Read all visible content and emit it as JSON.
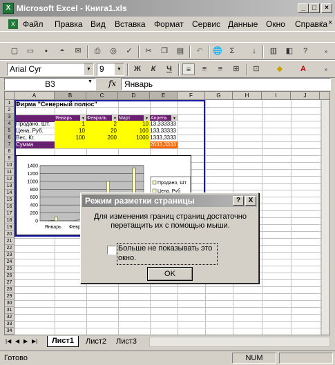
{
  "app": {
    "title": "Microsoft Excel - Книга1.xls"
  },
  "menu": [
    "Файл",
    "Правка",
    "Вид",
    "Вставка",
    "Формат",
    "Сервис",
    "Данные",
    "Окно",
    "Справка"
  ],
  "formatting": {
    "font": "Arial Cyr",
    "size": "9",
    "bold": "Ж",
    "italic": "К",
    "underline": "Ч",
    "font_color_glyph": "A"
  },
  "formula": {
    "cell_ref": "B3",
    "fx": "fx",
    "value": "Январь"
  },
  "columns": [
    "A",
    "B",
    "C",
    "D",
    "E",
    "F",
    "G",
    "H",
    "I",
    "J"
  ],
  "rows": [
    "1",
    "2",
    "3",
    "4",
    "5",
    "6",
    "7",
    "8",
    "9",
    "10",
    "11",
    "12",
    "13",
    "14",
    "15",
    "16",
    "17",
    "18",
    "19",
    "20",
    "21",
    "22",
    "23",
    "24",
    "25",
    "26",
    "27",
    "28",
    "29",
    "30",
    "31",
    "32",
    "33",
    "34"
  ],
  "sheet": {
    "title": "Фирма \"Северный полюс\"",
    "headers": [
      "Январь",
      "Февраль",
      "Март",
      "Апрель"
    ],
    "data_rows": [
      {
        "label": "Продано, Шт.",
        "values": [
          "1",
          "2",
          "10",
          "13,333333"
        ]
      },
      {
        "label": "Цена, Руб.",
        "values": [
          "10",
          "20",
          "100",
          "133,33333"
        ]
      },
      {
        "label": "Вес, Кг.",
        "values": [
          "100",
          "200",
          "1000",
          "1333,3333"
        ]
      },
      {
        "label": "Сумма",
        "values": [
          "",
          "",
          "",
          "2633,3333"
        ]
      }
    ]
  },
  "chart_data": {
    "type": "bar",
    "categories": [
      "Январь",
      "Февраль",
      "Март",
      "Апрель"
    ],
    "series": [
      {
        "name": "Продано, Шт",
        "values": [
          1,
          2,
          10,
          13.33
        ]
      },
      {
        "name": "Цена, Руб",
        "values": [
          10,
          20,
          100,
          133.33
        ]
      },
      {
        "name": "Вес, Кг",
        "values": [
          100,
          200,
          1000,
          1333.33
        ]
      }
    ],
    "ylim": [
      0,
      1400
    ],
    "yticks": [
      "1400",
      "1200",
      "1000",
      "800",
      "600",
      "400",
      "200",
      "0"
    ],
    "legend_visible": [
      "Продано, Шт",
      "Цена, Руб"
    ],
    "colors": [
      "#ffffc0",
      "#ffffc0",
      "#ffffc0"
    ]
  },
  "dialog": {
    "title": "Режим разметки страницы",
    "help": "?",
    "close": "X",
    "message_line1": "Для изменения границ страниц достаточно",
    "message_line2": "перетащить их с помощью мыши.",
    "checkbox_line1": "Больше не показывать это",
    "checkbox_line2": "окно.",
    "ok": "OK"
  },
  "tabs": [
    "Лист1",
    "Лист2",
    "Лист3"
  ],
  "status": {
    "ready": "Готово",
    "num": "NUM"
  }
}
